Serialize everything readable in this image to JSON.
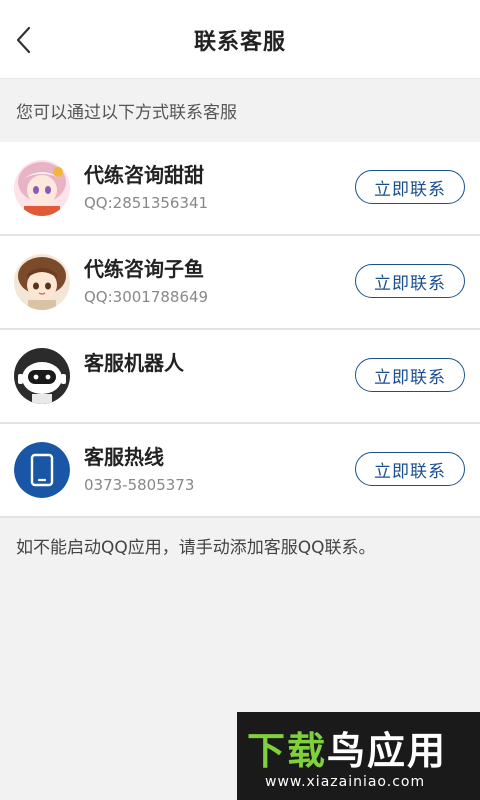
{
  "header": {
    "title": "联系客服"
  },
  "intro": "您可以通过以下方式联系客服",
  "contacts": [
    {
      "name": "代练咨询甜甜",
      "sub": "QQ:2851356341",
      "button": "立即联系",
      "avatar": "anime-girl-pink-avatar"
    },
    {
      "name": "代练咨询子鱼",
      "sub": "QQ:3001788649",
      "button": "立即联系",
      "avatar": "anime-girl-brown-avatar"
    },
    {
      "name": "客服机器人",
      "sub": "",
      "button": "立即联系",
      "avatar": "robot-avatar"
    },
    {
      "name": "客服热线",
      "sub": "0373-5805373",
      "button": "立即联系",
      "avatar": "phone-icon"
    }
  ],
  "note": "如不能启动QQ应用，请手动添加客服QQ联系。",
  "watermark": {
    "line1_part1": "下载",
    "line1_part2": "鸟应用",
    "url": "www.xiazainiao.com"
  },
  "colors": {
    "accent": "#1a4f8f",
    "watermark_green": "#7fd13b"
  }
}
